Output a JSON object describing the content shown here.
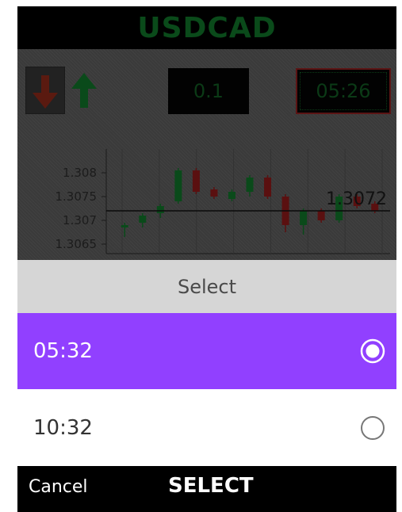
{
  "app": {
    "symbol": "USDCAD",
    "lots_value": "0.1",
    "expiry_value": "05:26",
    "chart_data": {
      "type": "candlestick",
      "current_price_label": "1.3072",
      "yticks": [
        "1.308",
        "1.3075",
        "1.307",
        "1.3065"
      ],
      "ylim": [
        1.3063,
        1.3085
      ],
      "current_price": 1.3072,
      "candles": [
        {
          "o": 1.30685,
          "c": 1.3069,
          "h": 1.30695,
          "l": 1.30665,
          "dir": "up"
        },
        {
          "o": 1.30695,
          "c": 1.3071,
          "h": 1.30715,
          "l": 1.30685,
          "dir": "up"
        },
        {
          "o": 1.30715,
          "c": 1.3073,
          "h": 1.30735,
          "l": 1.30705,
          "dir": "up"
        },
        {
          "o": 1.3074,
          "c": 1.30805,
          "h": 1.3081,
          "l": 1.30735,
          "dir": "up"
        },
        {
          "o": 1.30805,
          "c": 1.3076,
          "h": 1.3081,
          "l": 1.30755,
          "dir": "down"
        },
        {
          "o": 1.30765,
          "c": 1.3075,
          "h": 1.3077,
          "l": 1.30745,
          "dir": "down"
        },
        {
          "o": 1.30745,
          "c": 1.3076,
          "h": 1.30765,
          "l": 1.3074,
          "dir": "up"
        },
        {
          "o": 1.3076,
          "c": 1.3079,
          "h": 1.30795,
          "l": 1.3075,
          "dir": "up"
        },
        {
          "o": 1.3079,
          "c": 1.3075,
          "h": 1.30795,
          "l": 1.30745,
          "dir": "down"
        },
        {
          "o": 1.3075,
          "c": 1.3069,
          "h": 1.30755,
          "l": 1.30675,
          "dir": "down"
        },
        {
          "o": 1.3069,
          "c": 1.3072,
          "h": 1.30725,
          "l": 1.3067,
          "dir": "up"
        },
        {
          "o": 1.3072,
          "c": 1.307,
          "h": 1.30725,
          "l": 1.30695,
          "dir": "down"
        },
        {
          "o": 1.307,
          "c": 1.3075,
          "h": 1.30755,
          "l": 1.30695,
          "dir": "up"
        },
        {
          "o": 1.3075,
          "c": 1.3073,
          "h": 1.30755,
          "l": 1.30725,
          "dir": "down"
        },
        {
          "o": 1.30735,
          "c": 1.3072,
          "h": 1.3074,
          "l": 1.30715,
          "dir": "down"
        }
      ]
    }
  },
  "dialog": {
    "title": "Select",
    "options": [
      {
        "label": "05:32",
        "selected": true
      },
      {
        "label": "10:32",
        "selected": false
      }
    ],
    "cancel_label": "Cancel",
    "select_label": "SELECT"
  },
  "colors": {
    "accent": "#9140ff",
    "up_candle": "#0a4a1a",
    "down_candle": "#5a1010"
  },
  "icons": {
    "down_arrow": "arrow-down-icon",
    "up_arrow": "arrow-up-icon",
    "radio_checked": "radio-checked-icon",
    "radio_unchecked": "radio-unchecked-icon"
  }
}
